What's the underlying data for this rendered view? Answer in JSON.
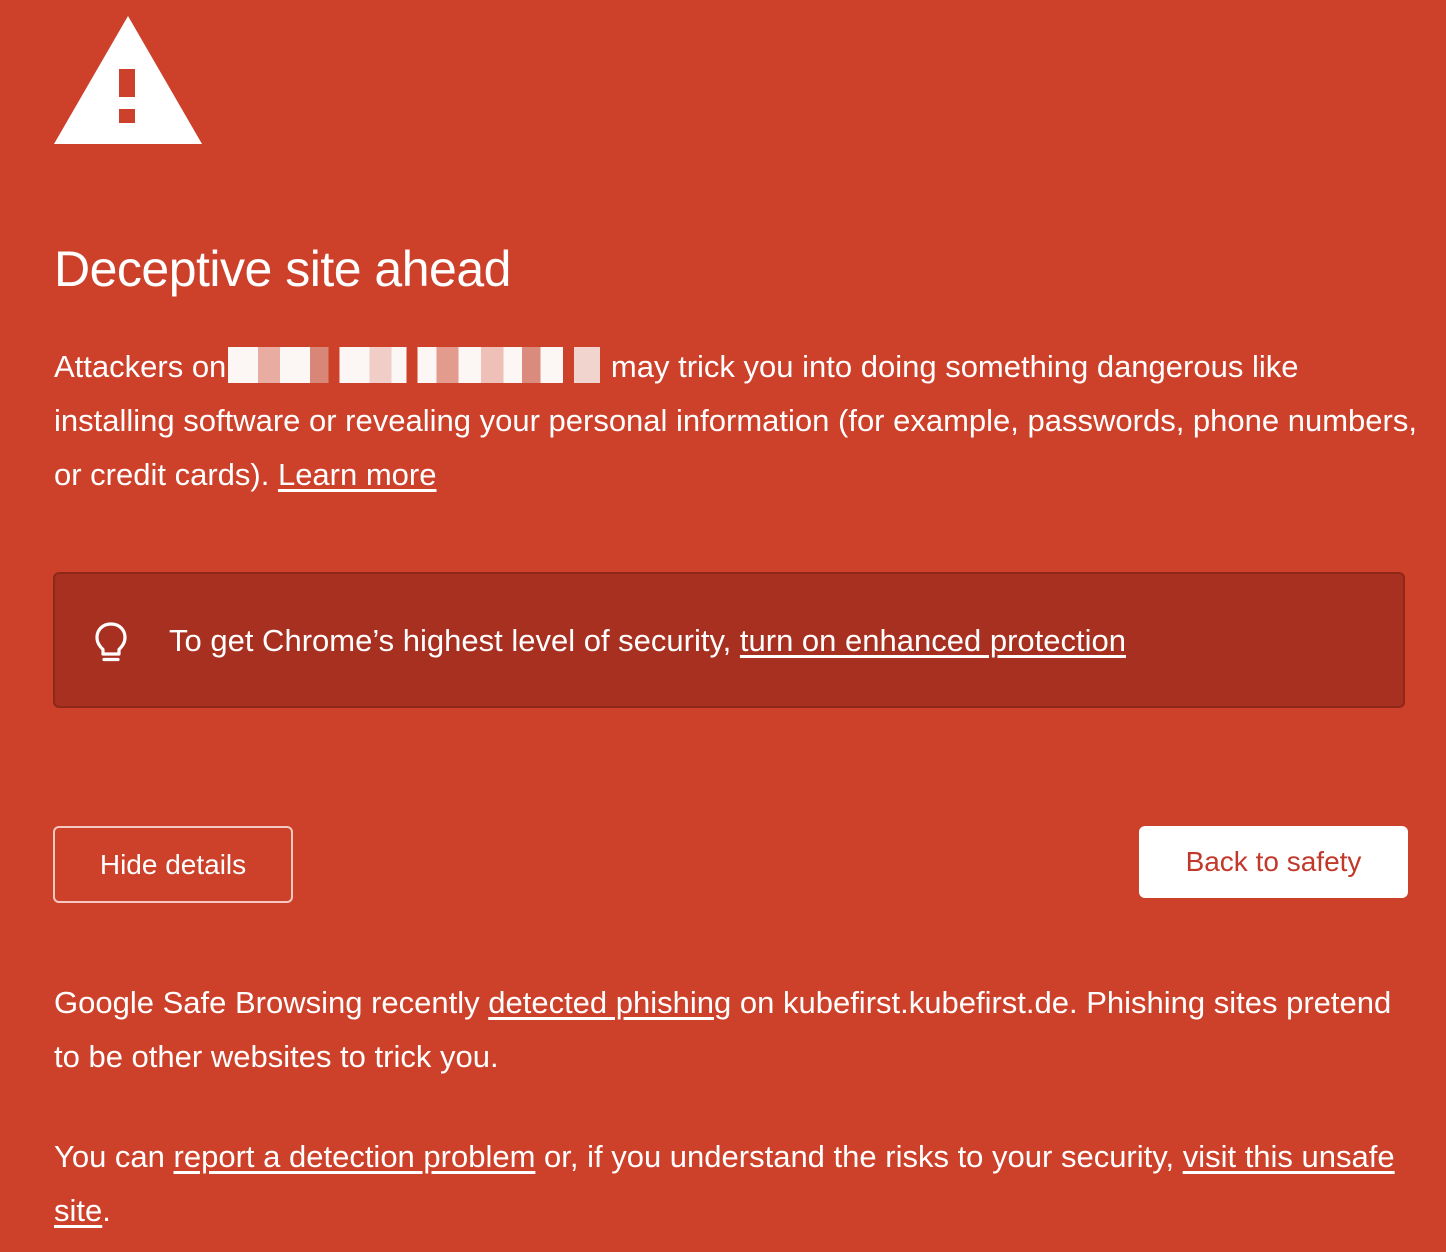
{
  "colors": {
    "background": "#cd412b",
    "callout_background": "#a83020",
    "text": "#ffffff",
    "primary_button_text": "#c0392b"
  },
  "header": {
    "icon": "warning-triangle-icon",
    "title": "Deceptive site ahead"
  },
  "main": {
    "text_before_url": "Attackers on",
    "text_after_url": " may trick you into doing something dangerous like installing software or revealing your personal information (for example, passwords, phone numbers, or credit cards). ",
    "learn_more_link": "Learn more"
  },
  "callout": {
    "icon": "lightbulb-icon",
    "text": "To get Chrome’s highest level of security, ",
    "link": "turn on enhanced protection"
  },
  "buttons": {
    "hide_details": "Hide details",
    "back_to_safety": "Back to safety"
  },
  "details": {
    "p1_before": "Google Safe Browsing recently ",
    "p1_link": "detected phishing",
    "p1_after": " on kubefirst.kubefirst.de. Phishing sites pretend to be other websites to trick you.",
    "p2_before": "You can ",
    "p2_link1": "report a detection problem",
    "p2_middle": " or, if you understand the risks to your security, ",
    "p2_link2": "visit this unsafe site",
    "p2_after": "."
  }
}
